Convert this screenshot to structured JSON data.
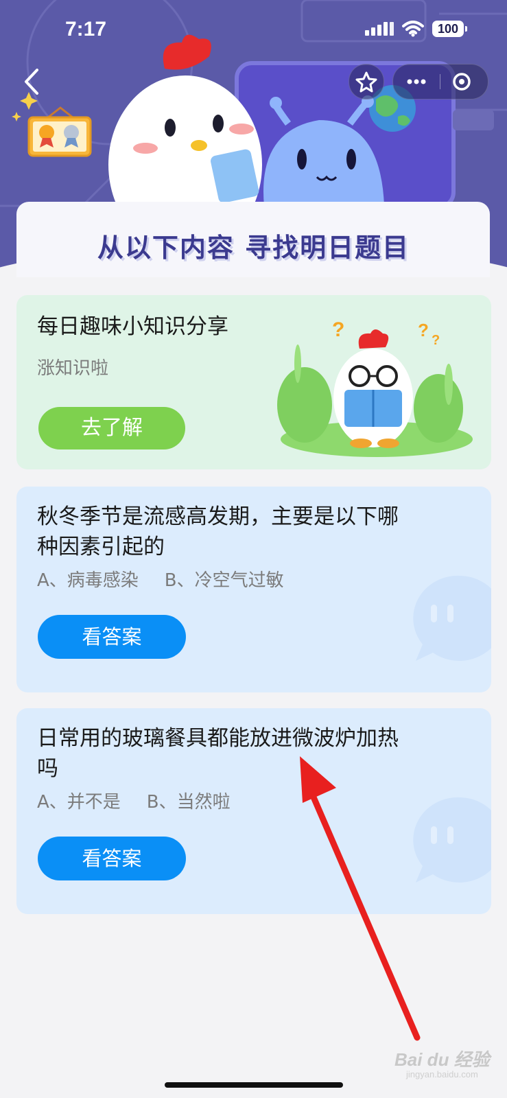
{
  "status_bar": {
    "time": "7:17",
    "battery": "100"
  },
  "hero": {
    "title": "从以下内容 寻找明日题目"
  },
  "knowledge_card": {
    "title": "每日趣味小知识分享",
    "subtitle": "涨知识啦",
    "button_label": "去了解"
  },
  "questions": [
    {
      "title_line1": "秋冬季节是流感高发期，主要是以下哪",
      "title_line2": "种因素引起的",
      "option_a": "A、病毒感染",
      "option_b": "B、冷空气过敏",
      "button_label": "看答案"
    },
    {
      "title_line1": "日常用的玻璃餐具都能放进微波炉加热",
      "title_line2": "吗",
      "option_a": "A、并不是",
      "option_b": "B、当然啦",
      "button_label": "看答案"
    }
  ],
  "watermark": {
    "brand": "Bai du 经验",
    "url": "jingyan.baidu.com"
  },
  "colors": {
    "hero_bg": "#5b5aa8",
    "green_card": "#dff4e7",
    "blue_card": "#dcecfd",
    "green_button": "#7ed14e",
    "blue_button": "#0a8ff6",
    "annotation_arrow": "#e8201f"
  }
}
